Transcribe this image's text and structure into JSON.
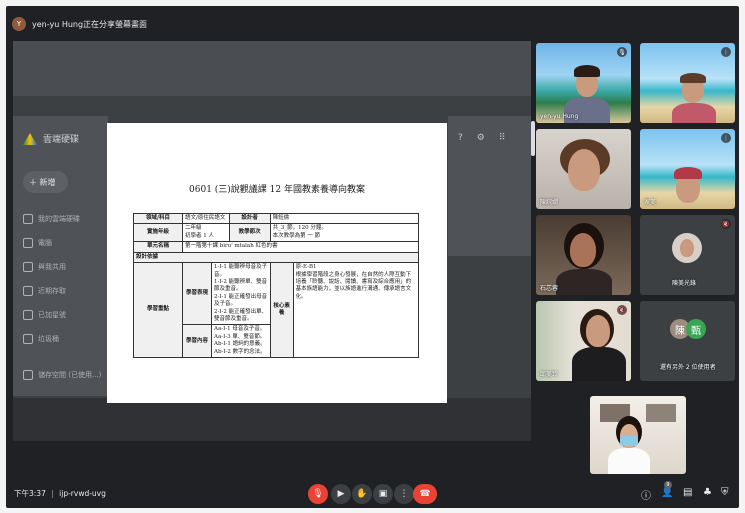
{
  "header": {
    "presenter_text": "yen-yu Hung正在分享螢幕畫面",
    "avatar_initial": "Y"
  },
  "background_drive": {
    "title": "雲端硬碟",
    "new_label": "新增",
    "nav": [
      "我的雲端硬碟",
      "電腦",
      "與我共用",
      "近期存取",
      "已加星號",
      "垃圾桶",
      "儲存空間 (已使用...)"
    ]
  },
  "document": {
    "title": "0601 (三)說觀議課 12 年國教素養導向教案",
    "rows": [
      {
        "label": "領域/科目",
        "value": "語文/原住民語文",
        "label2": "設計者",
        "value2": "陳鈺倫"
      },
      {
        "label": "實施年級",
        "value": "二年級\n初學者 1 人",
        "label2": "教學節次",
        "value2": "共_3_節，120 分鐘。\n本次教學為第 一 節"
      },
      {
        "label": "單元名稱",
        "value": "第一階第十課 biru' mtalah 紅色的書"
      },
      {
        "label": "設計依據"
      }
    ],
    "side_label": "學習重點",
    "perf_label": "學習表現",
    "content_label": "學習內容",
    "core_label": "核心素養",
    "performance": "1-Ⅰ-1 能聽辨母音及子音。\n1-Ⅰ-2 能聽辨單、雙音節及重音。\n2-Ⅰ-1 能正確發出母音及子音。\n2-Ⅰ-2 能正確發出單、雙音節及重音。",
    "content": "Aa-Ⅰ-1 母音及子音。\nAa-Ⅰ-3 單、雙音節。\nAb-Ⅰ-1 語詞的意義。\nAb-Ⅰ-2 數字的念法。",
    "core": "原-E-B1\n根據學習階段之身心發展，在自然的人際互動下培養「聆聽、說話、閱讀、書寫及綜合應用」的基本族語能力，並以族語進行溝通、傳承語言文化。"
  },
  "participants": [
    {
      "name": "yen-yu Hung",
      "bg": "beach",
      "mic": "🎙"
    },
    {
      "name": "",
      "bg": "palm",
      "mic": "⋮"
    },
    {
      "name": "陳婉嫻",
      "bg": "room",
      "mic": ""
    },
    {
      "name": "家美",
      "bg": "palm",
      "mic": "⋮"
    },
    {
      "name": "石芯蓉",
      "bg": "dark",
      "mic": ""
    },
    {
      "name": "陳美光錄",
      "bg": "avatar",
      "mic": "🔇"
    },
    {
      "name": "邱美玲",
      "bg": "window",
      "mic": "🔇"
    },
    {
      "name": "還有另外 2 位使用者",
      "bg": "group",
      "mic": ""
    }
  ],
  "bottom": {
    "time": "下午3:37",
    "separator": "|",
    "meeting_code": "ijp-rvwd-uvg",
    "people_count": "9"
  },
  "colors": {
    "end_call": "#ea4335",
    "bar_bg": "#202124",
    "tile_bg": "#3c4043"
  }
}
